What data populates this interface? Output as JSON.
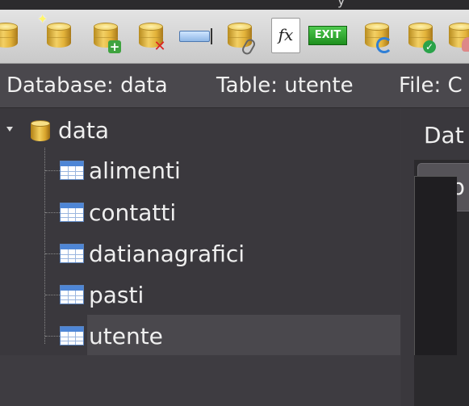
{
  "toolbar": {
    "buttons": [
      {
        "name": "new-database-icon"
      },
      {
        "name": "open-database-icon"
      },
      {
        "name": "add-table-icon"
      },
      {
        "name": "delete-table-icon"
      },
      {
        "name": "edit-field-icon"
      },
      {
        "name": "attach-database-icon"
      },
      {
        "name": "function-icon",
        "label": "fx"
      },
      {
        "name": "exit-icon",
        "label": "EXIT"
      },
      {
        "name": "refresh-database-icon"
      },
      {
        "name": "check-database-icon"
      },
      {
        "name": "user-database-icon"
      }
    ]
  },
  "infobar": {
    "database": "Database: data",
    "table": "Table: utente",
    "file": "File: C"
  },
  "tree": {
    "root": "data",
    "tables": [
      "alimenti",
      "contatti",
      "datianagrafici",
      "pasti",
      "utente"
    ],
    "selected": "utente"
  },
  "right_panel": {
    "label": "Dat",
    "tab": "tab"
  },
  "colors": {
    "background": "#3c3a3f",
    "toolbar": "#d6d6d6",
    "selection": "#4a484d"
  }
}
